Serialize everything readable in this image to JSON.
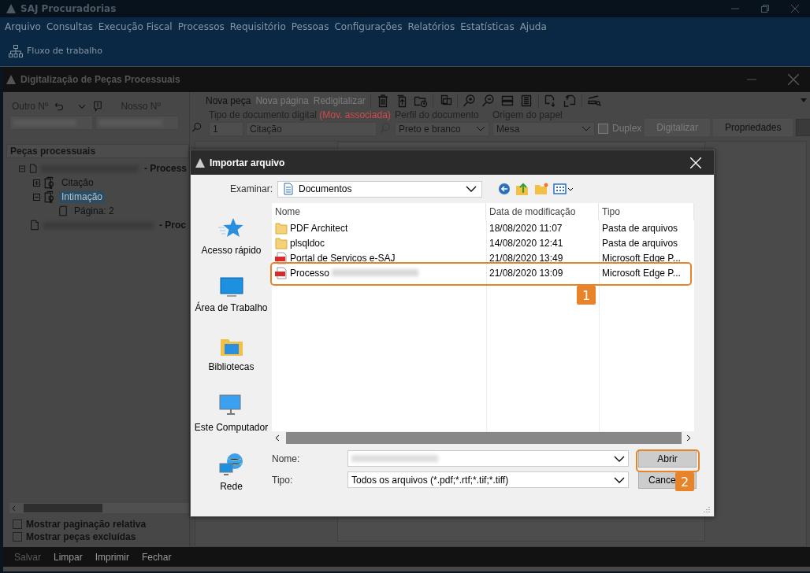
{
  "app": {
    "title": "SAJ Procuradorias",
    "menu": [
      "Arquivo",
      "Consultas",
      "Execução Fiscal",
      "Processos",
      "Requisitório",
      "Pessoas",
      "Configurações",
      "Relatórios",
      "Estatísticas",
      "Ajuda"
    ],
    "toolbar": [
      "Fluxo de trabalho"
    ]
  },
  "window": {
    "title": "Digitalização de Peças Processuais"
  },
  "search_panel": {
    "labels": [
      "Outro Nº",
      "Nosso Nº"
    ]
  },
  "pieces": {
    "title": "Peças processuais",
    "tree": [
      {
        "label": "- Process",
        "kind": "document",
        "expanded": true,
        "selected": false,
        "children": [
          {
            "label": "Citação",
            "kind": "stamp",
            "expanded": false,
            "selected": false
          },
          {
            "label": "Intimação",
            "kind": "stamp",
            "expanded": true,
            "selected": true,
            "children": [
              {
                "label": "Página: 2",
                "kind": "page",
                "selected": false
              }
            ]
          }
        ]
      },
      {
        "label": "- Proc",
        "kind": "document",
        "selected": false
      }
    ]
  },
  "options": [
    {
      "label": "Mostrar paginação relativa",
      "checked": false
    },
    {
      "label": "Mostrar peças excluídas",
      "checked": false
    }
  ],
  "doc_toolbar": [
    {
      "label": "Nova peça",
      "disabled": false
    },
    {
      "label": "Nova página",
      "disabled": true
    },
    {
      "label": "Redigitalizar",
      "disabled": true
    }
  ],
  "doc_form": {
    "type_label": "Tipo de documento digital",
    "type_note": "(Mov. associada)",
    "type_code": "1",
    "type_name": "Citação",
    "profile_label": "Perfil do documento",
    "profile": "Preto e branco",
    "origin_label": "Origem do papel",
    "origin": "Mesa",
    "duplex": {
      "label": "Duplex",
      "checked": false,
      "disabled": true
    },
    "buttons": [
      {
        "label": "Digitalizar",
        "disabled": true
      },
      {
        "label": "Propriedades",
        "disabled": false
      }
    ]
  },
  "footer": [
    {
      "label": "Salvar",
      "disabled": true
    },
    {
      "label": "Limpar",
      "disabled": false
    },
    {
      "label": "Imprimir",
      "disabled": false
    },
    {
      "label": "Fechar",
      "disabled": false
    }
  ],
  "dialog": {
    "title": "Importar arquivo",
    "look_in_label": "Examinar:",
    "look_in": "Documentos",
    "places": [
      {
        "label": "Acesso rápido",
        "kind": "star"
      },
      {
        "label": "Área de Trabalho",
        "kind": "desktop"
      },
      {
        "label": "Bibliotecas",
        "kind": "library"
      },
      {
        "label": "Este Computador",
        "kind": "computer"
      },
      {
        "label": "Rede",
        "kind": "network"
      }
    ],
    "columns": [
      "Nome",
      "Data de modificação",
      "Tipo"
    ],
    "files": [
      {
        "name": "PDF Architect",
        "kind": "folder",
        "modified": "18/08/2020 11:07",
        "type": "Pasta de arquivos"
      },
      {
        "name": "plsqldoc",
        "kind": "folder",
        "modified": "14/08/2020 12:41",
        "type": "Pasta de arquivos"
      },
      {
        "name": "Portal de Servicos e-SAJ",
        "kind": "pdf",
        "modified": "21/08/2020 13:49",
        "type": "Microsoft Edge P..."
      },
      {
        "name": "Processo",
        "kind": "pdf",
        "modified": "21/08/2020 13:09",
        "type": "Microsoft Edge P..."
      }
    ],
    "name_label": "Nome:",
    "type_label": "Tipo:",
    "file_type": "Todos os arquivos (*.pdf;*.rtf;*.tif;*.tiff)",
    "buttons": [
      "Abrir",
      "Cance"
    ]
  },
  "callouts": [
    "1",
    "2"
  ]
}
